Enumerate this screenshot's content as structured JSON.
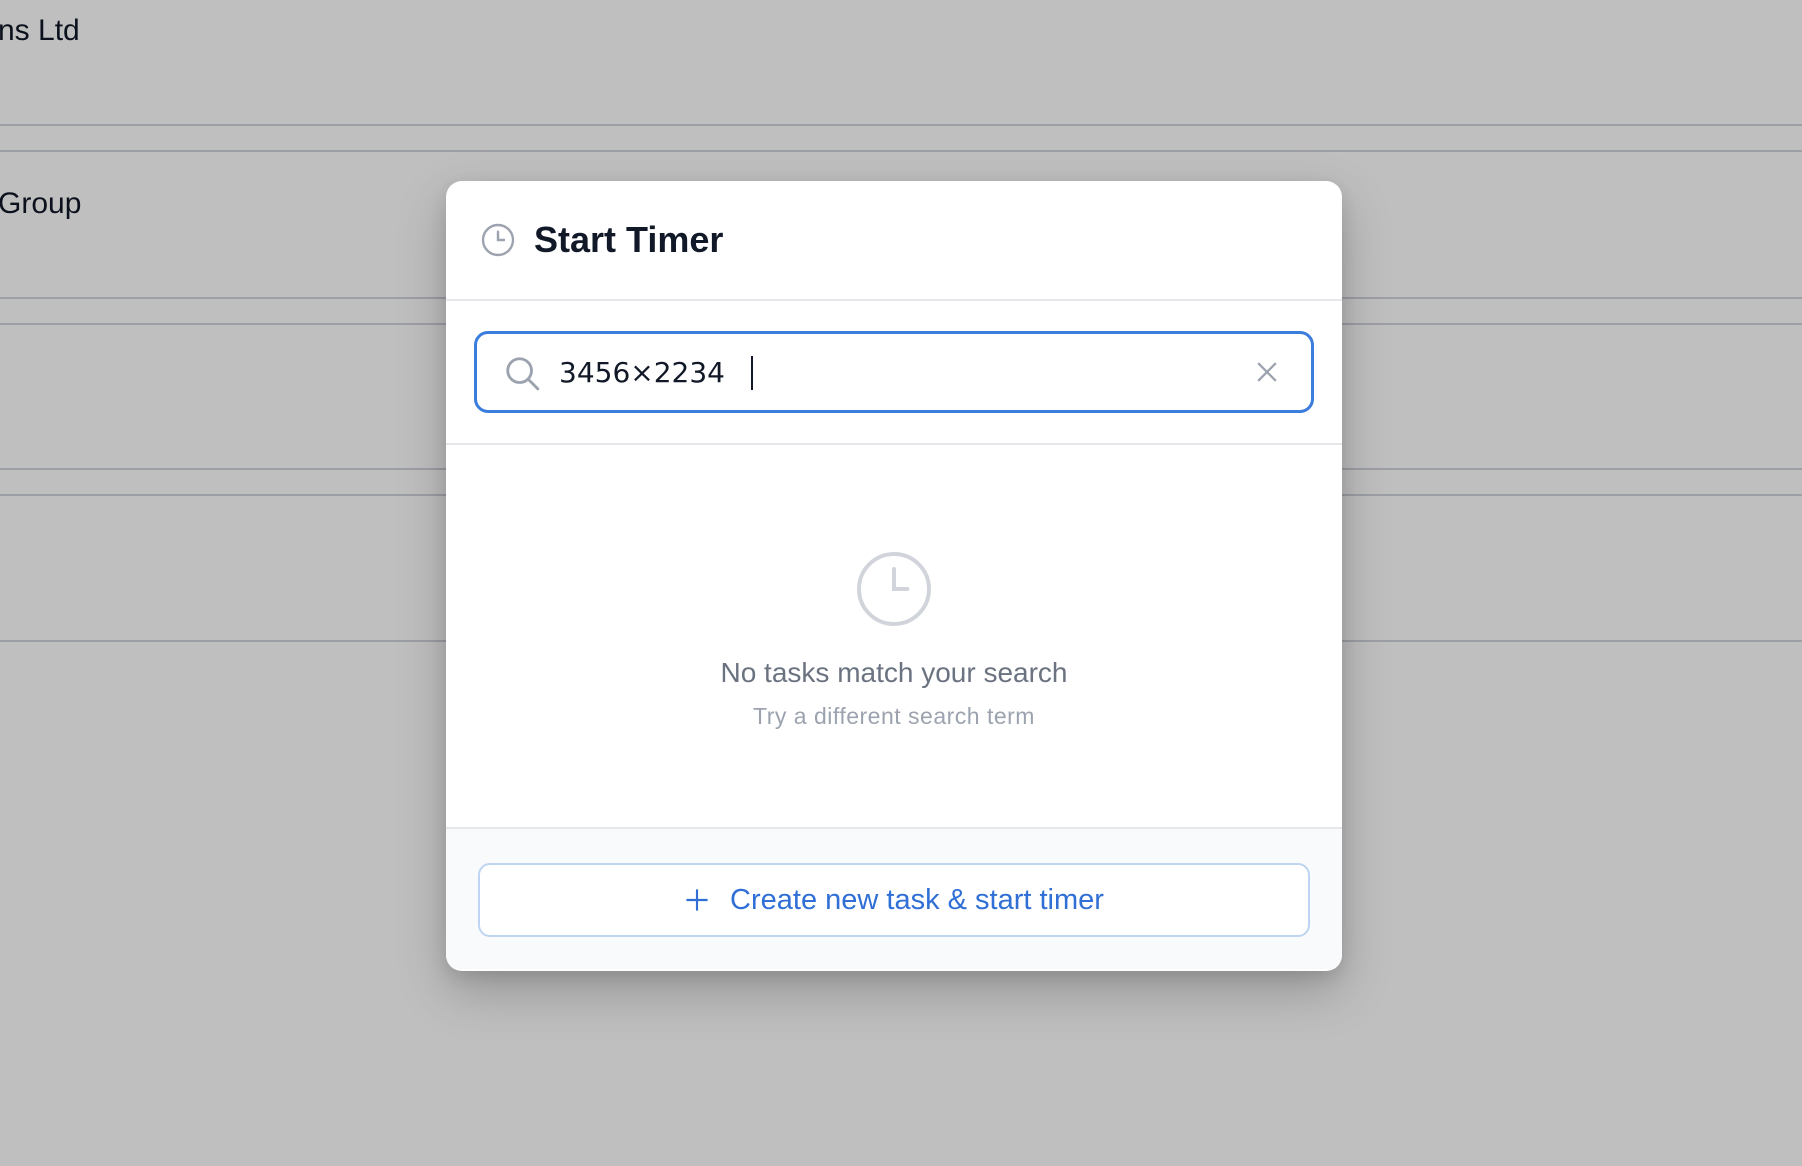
{
  "background": {
    "rows": [
      {
        "label": "ns Ltd"
      },
      {
        "label": "Group"
      }
    ]
  },
  "modal": {
    "title": "Start Timer",
    "header_icon": "clock-icon",
    "search": {
      "value": "3456×2234",
      "icon": "search-icon",
      "clear_icon": "close-icon",
      "focus_color": "#3b7ddd"
    },
    "empty_state": {
      "icon": "clock-icon",
      "title": "No tasks match your search",
      "subtitle": "Try a different search term"
    },
    "footer": {
      "create_label": "Create new task & start timer",
      "create_icon": "plus-icon",
      "accent_color": "#2f6fd6"
    }
  }
}
